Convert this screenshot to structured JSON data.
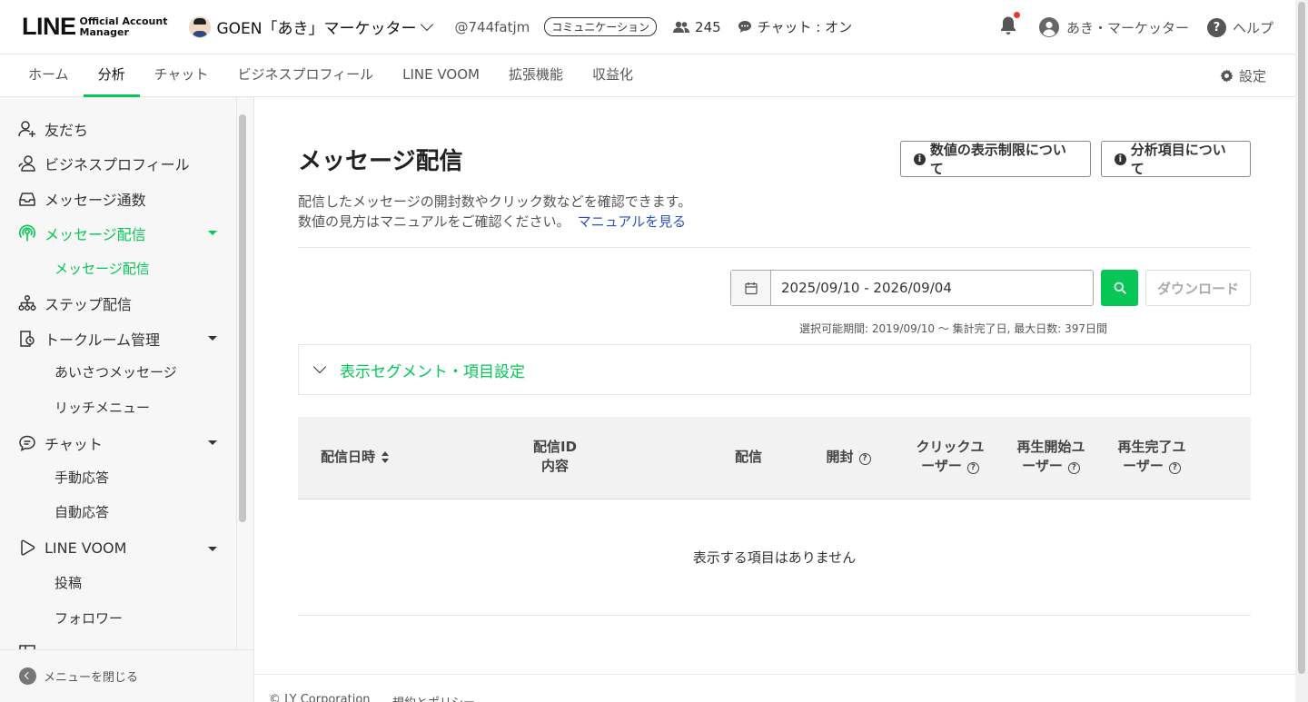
{
  "header": {
    "logo_main": "LINE",
    "logo_sub_1": "Official Account",
    "logo_sub_2": "Manager",
    "account_name": "GOEN「あき」マーケッター",
    "account_id": "@744fatjm",
    "badge": "コミュニケーション",
    "friends_count": "245",
    "chat_status": "チャット : オン",
    "user_name": "あき・マーケッター",
    "help": "ヘルプ"
  },
  "nav": {
    "items": [
      "ホーム",
      "分析",
      "チャット",
      "ビジネスプロフィール",
      "LINE VOOM",
      "拡張機能",
      "収益化"
    ],
    "active": "分析",
    "settings": "設定"
  },
  "sidebar": {
    "items": [
      {
        "label": "友だち",
        "icon": "user-plus-icon"
      },
      {
        "label": "ビジネスプロフィール",
        "icon": "users-icon"
      },
      {
        "label": "メッセージ通数",
        "icon": "inbox-icon"
      },
      {
        "label": "メッセージ配信",
        "icon": "broadcast-icon"
      },
      {
        "label": "ステップ配信",
        "icon": "hierarchy-icon"
      },
      {
        "label": "トークルーム管理",
        "icon": "room-icon"
      },
      {
        "label": "チャット",
        "icon": "chat-icon"
      },
      {
        "label": "LINE VOOM",
        "icon": "play-icon"
      }
    ],
    "subs": {
      "message": "メッセージ配信",
      "greeting": "あいさつメッセージ",
      "richmenu": "リッチメニュー",
      "manual": "手動応答",
      "auto": "自動応答",
      "post": "投稿",
      "follower": "フォロワー"
    },
    "close_menu": "メニューを閉じる"
  },
  "main": {
    "title": "メッセージ配信",
    "btn_limit": "数値の表示制限について",
    "btn_items": "分析項目について",
    "desc_line1": "配信したメッセージの開封数やクリック数などを確認できます。",
    "desc_line2": "数値の見方はマニュアルをご確認ください。",
    "manual_link": "マニュアルを見る",
    "date_range": "2025/09/10 - 2026/09/04",
    "download": "ダウンロード",
    "period_note": "選択可能期間: 2019/09/10 〜 集計完了日, 最大日数: 397日間",
    "segment_label": "表示セグメント・項目設定",
    "columns": {
      "date": "配信日時",
      "id_1": "配信ID",
      "id_2": "内容",
      "delivery": "配信",
      "open": "開封",
      "click_1": "クリックユ",
      "click_2": "ーザー",
      "play_start_1": "再生開始ユ",
      "play_start_2": "ーザー",
      "play_end_1": "再生完了ユ",
      "play_end_2": "ーザー"
    },
    "empty": "表示する項目はありません"
  },
  "footer": {
    "copyright": "© LY Corporation",
    "policy": "規約とポリシー"
  },
  "colors": {
    "accent": "#06c755",
    "link": "#2b50c7",
    "notification": "#e53935"
  }
}
